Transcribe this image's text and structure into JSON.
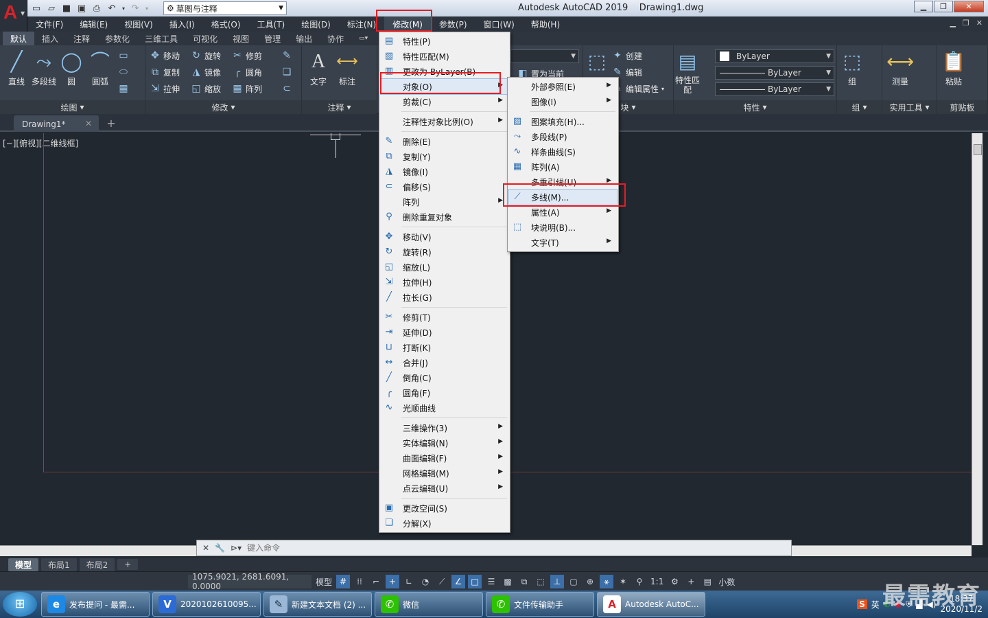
{
  "window": {
    "app": "Autodesk AutoCAD 2019",
    "file": "Drawing1.dwg",
    "workspace": "草图与注释",
    "logo": "A"
  },
  "menubar": [
    "文件(F)",
    "编辑(E)",
    "视图(V)",
    "插入(I)",
    "格式(O)",
    "工具(T)",
    "绘图(D)",
    "标注(N)",
    "修改(M)",
    "参数(P)",
    "窗口(W)",
    "帮助(H)"
  ],
  "ribbon_tabs": [
    "默认",
    "插入",
    "注释",
    "参数化",
    "三维工具",
    "可视化",
    "视图",
    "管理",
    "输出",
    "协作"
  ],
  "ribbon": {
    "draw": {
      "title": "绘图",
      "line": "直线",
      "pline": "多段线",
      "circle": "圆",
      "arc": "圆弧"
    },
    "modify": {
      "title": "修改",
      "move": "移动",
      "rotate": "旋转",
      "trim": "修剪",
      "copy": "复制",
      "mirror": "镜像",
      "fillet": "圆角",
      "stretch": "拉伸",
      "scale": "缩放",
      "array": "阵列"
    },
    "annotation": {
      "title": "注释",
      "text": "文字",
      "dim": "标注"
    },
    "layers": {
      "set_current": "置为当前"
    },
    "block": {
      "title": "块",
      "create": "创建",
      "edit": "编辑",
      "edit_attr": "编辑属性"
    },
    "properties": {
      "title": "特性",
      "match": "特性匹配",
      "color": "ByLayer",
      "linetype": "ByLayer",
      "lineweight": "ByLayer"
    },
    "groups": {
      "title": "组",
      "group": "组"
    },
    "utilities": {
      "title": "实用工具",
      "measure": "测量"
    },
    "clipboard": {
      "title": "剪贴板",
      "paste": "粘贴"
    }
  },
  "doc_tab": "Drawing1*",
  "view_label": "[−][俯视][二维线框]",
  "command_placeholder": "键入命令",
  "layout_tabs": [
    "模型",
    "布局1",
    "布局2"
  ],
  "status": {
    "coords": "1075.9021, 2681.6091, 0.0000",
    "model": "模型",
    "scale": "1:1",
    "units": "小数"
  },
  "modify_menu": [
    {
      "label": "特性(P)",
      "icon": "properties-icon"
    },
    {
      "label": "特性匹配(M)",
      "icon": "match-properties-icon"
    },
    {
      "label": "更改为 ByLayer(B)",
      "icon": "bylayer-icon"
    },
    {
      "label": "对象(O)",
      "submenu": true,
      "highlighted": true
    },
    {
      "label": "剪裁(C)",
      "submenu": true
    },
    {
      "sep": true
    },
    {
      "label": "注释性对象比例(O)",
      "submenu": true
    },
    {
      "sep": true
    },
    {
      "label": "删除(E)",
      "icon": "erase-icon"
    },
    {
      "label": "复制(Y)",
      "icon": "copy-icon"
    },
    {
      "label": "镜像(I)",
      "icon": "mirror-icon"
    },
    {
      "label": "偏移(S)",
      "icon": "offset-icon"
    },
    {
      "label": "阵列",
      "submenu": true
    },
    {
      "label": "删除重复对象",
      "icon": "overkill-icon"
    },
    {
      "sep": true
    },
    {
      "label": "移动(V)",
      "icon": "move-icon"
    },
    {
      "label": "旋转(R)",
      "icon": "rotate-icon"
    },
    {
      "label": "缩放(L)",
      "icon": "scale-icon"
    },
    {
      "label": "拉伸(H)",
      "icon": "stretch-icon"
    },
    {
      "label": "拉长(G)",
      "icon": "lengthen-icon"
    },
    {
      "sep": true
    },
    {
      "label": "修剪(T)",
      "icon": "trim-icon"
    },
    {
      "label": "延伸(D)",
      "icon": "extend-icon"
    },
    {
      "label": "打断(K)",
      "icon": "break-icon"
    },
    {
      "label": "合并(J)",
      "icon": "join-icon"
    },
    {
      "label": "倒角(C)",
      "icon": "chamfer-icon"
    },
    {
      "label": "圆角(F)",
      "icon": "fillet-icon"
    },
    {
      "label": "光顺曲线",
      "icon": "blend-icon"
    },
    {
      "sep": true
    },
    {
      "label": "三维操作(3)",
      "submenu": true
    },
    {
      "label": "实体编辑(N)",
      "submenu": true
    },
    {
      "label": "曲面编辑(F)",
      "submenu": true
    },
    {
      "label": "网格编辑(M)",
      "submenu": true
    },
    {
      "label": "点云编辑(U)",
      "submenu": true
    },
    {
      "sep": true
    },
    {
      "label": "更改空间(S)",
      "icon": "change-space-icon"
    },
    {
      "label": "分解(X)",
      "icon": "explode-icon"
    }
  ],
  "object_submenu": [
    {
      "label": "外部参照(E)",
      "submenu": true
    },
    {
      "label": "图像(I)",
      "submenu": true
    },
    {
      "sep": true
    },
    {
      "label": "图案填充(H)...",
      "icon": "hatch-edit-icon"
    },
    {
      "label": "多段线(P)",
      "icon": "pedit-icon"
    },
    {
      "label": "样条曲线(S)",
      "icon": "spline-edit-icon"
    },
    {
      "label": "阵列(A)",
      "icon": "array-edit-icon"
    },
    {
      "label": "多重引线(U)",
      "submenu": true
    },
    {
      "label": "多线(M)...",
      "icon": "mline-edit-icon",
      "highlighted": true
    },
    {
      "label": "属性(A)",
      "submenu": true
    },
    {
      "label": "块说明(B)...",
      "icon": "block-desc-icon"
    },
    {
      "label": "文字(T)",
      "submenu": true
    }
  ],
  "taskbar": [
    {
      "label": "发布提问 - 最需...",
      "icon": "e"
    },
    {
      "label": "2020102610095...",
      "icon": "V"
    },
    {
      "label": "新建文本文档 (2) ...",
      "icon": "✎"
    },
    {
      "label": "微信",
      "icon": "✆"
    },
    {
      "label": "文件传输助手",
      "icon": "✆"
    },
    {
      "label": "Autodesk AutoC...",
      "icon": "A"
    }
  ],
  "tray": {
    "ime": "英",
    "time": "18:37",
    "date": "2020/11/2"
  },
  "watermark": "最需教育",
  "colors": {
    "accent": "#3c6ea8",
    "highlight": "#e51c23"
  }
}
